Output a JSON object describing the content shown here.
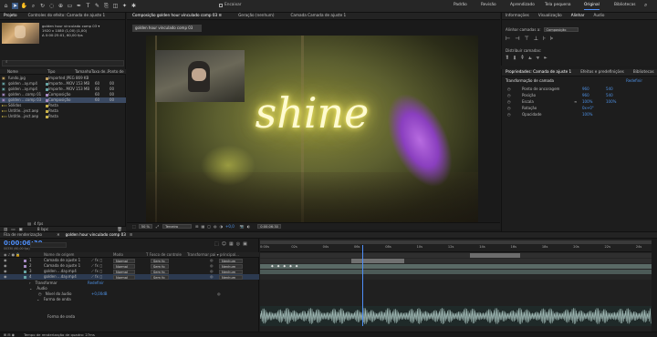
{
  "toolbar": {
    "tools": [
      "home-icon",
      "selection-tool-icon",
      "hand-tool-icon",
      "zoom-tool-icon",
      "rotate-tool-icon",
      "orbit-camera-icon",
      "pan-behind-icon",
      "rectangle-tool-icon",
      "pen-tool-icon",
      "type-tool-icon",
      "brush-tool-icon",
      "clone-stamp-icon",
      "eraser-tool-icon",
      "roto-brush-icon",
      "puppet-pin-icon"
    ],
    "snap_label": "Encaixar",
    "workspaces": [
      "Padrão",
      "Revisão",
      "Aprendizado",
      "Tela pequena",
      "Original",
      "Bibliotecas"
    ],
    "active_workspace": "Original"
  },
  "project": {
    "tab": "Projeto",
    "controls_tab": "Controles do efeito: Camada de ajuste 1",
    "preview_name": "golden hour vinculado comp 03 ▾",
    "preview_info1": "1920 x 1080 (1,00) (1,00)",
    "preview_info2": "Δ 0:00:25:01, 60,00 fps",
    "search_placeholder": "⌕",
    "columns": [
      "Nome",
      "Tipo",
      "Tamanho",
      "Taxa de...",
      "Ponto de"
    ],
    "items": [
      {
        "name": "fundo.jpg",
        "type": "Imported JPEG",
        "size": "869 KB",
        "rate": "",
        "point": "",
        "color": "#c0a060"
      },
      {
        "name": "golden ..ay.mp4",
        "type": "Importe...MOV",
        "size": "153 MB",
        "rate": "60",
        "point": "00",
        "color": "#66a3a3"
      },
      {
        "name": "golden ..ay.mp4",
        "type": "Importe...MOV",
        "size": "153 MB",
        "rate": "60",
        "point": "00",
        "color": "#66a3a3"
      },
      {
        "name": "golden ...comp 01",
        "type": "Composição",
        "size": "",
        "rate": "60",
        "point": "00",
        "color": "#a58ac2"
      },
      {
        "name": "golden ...comp 03",
        "type": "Composição",
        "size": "",
        "rate": "60",
        "point": "00",
        "color": "#a58ac2"
      },
      {
        "name": "Sólidos",
        "type": "Pasta",
        "size": "",
        "rate": "",
        "point": "",
        "color": "#c9b24a"
      },
      {
        "name": "Untitle...ject.aep",
        "type": "Pasta",
        "size": "",
        "rate": "",
        "point": "",
        "color": "#c9b24a"
      },
      {
        "name": "Untitle...ject.aep",
        "type": "Pasta",
        "size": "",
        "rate": "",
        "point": "",
        "color": "#c9b24a"
      }
    ],
    "bpc": "8 bpc"
  },
  "viewer": {
    "tabs": [
      "Composição golden hour vinculado comp 03 ≡",
      "Geração (nenhum)",
      "Camada Camada de ajuste 1"
    ],
    "comp_tag": "golden hour vinculado comp 03",
    "overlay_text": "shine",
    "zoom": "50 %",
    "quality": "Terceiro",
    "time": "0:00:06:30",
    "plus": "+0,0"
  },
  "info_panel": {
    "tabs": [
      "Informações",
      "Visualização",
      "Alinhar",
      "Áudio"
    ],
    "align_label": "Alinhar camadas a:",
    "align_target": "Composição",
    "distribute_label": "Distribuir camadas:"
  },
  "properties": {
    "tabs": [
      "Propriedades: Camada de ajuste 1",
      "Efeitos e predefinições",
      "Bibliotecas"
    ],
    "section": "Transformação de camada",
    "reset": "Redefinir",
    "rows": [
      {
        "label": "Ponto de ancoragem",
        "v1": "960",
        "v2": "540"
      },
      {
        "label": "Posição",
        "v1": "960",
        "v2": "540"
      },
      {
        "label": "Escala",
        "v1": "100%",
        "v2": "100%"
      },
      {
        "label": "Rotação",
        "v1": "0x+0°",
        "v2": ""
      },
      {
        "label": "Opacidade",
        "v1": "100%",
        "v2": ""
      }
    ]
  },
  "render_queue": {
    "tab": "Fila de renderização",
    "fps": "4 fps"
  },
  "timeline": {
    "tab": "golden hour vinculado comp 03",
    "current_time": "0:00:06:30",
    "frame_sub": "00330 (60,00 fps)",
    "columns": [
      "Nome de origem",
      "Modo",
      "T Fosco de controle",
      "Transformar pai ▾ principal..."
    ],
    "layers": [
      {
        "num": "1",
        "name": "Camada de ajuste 1",
        "mode": "Normal",
        "matte": "Sem fo",
        "parent": "Nenhum",
        "color": "#a58ac2"
      },
      {
        "num": "2",
        "name": "Camada de ajuste 1",
        "mode": "Normal",
        "matte": "Sem fo",
        "parent": "Nenhum",
        "color": "#a58ac2"
      },
      {
        "num": "3",
        "name": "golden ...day.mp4",
        "mode": "Normal",
        "matte": "Sem fo",
        "parent": "Nenhum",
        "color": "#66a3a3"
      },
      {
        "num": "4",
        "name": "golden ...day.mp4",
        "mode": "Normal",
        "matte": "Sem fo",
        "parent": "Nenhum",
        "color": "#66a3a3"
      }
    ],
    "transform_label": "Transformar",
    "transform_reset": "Redefinir",
    "audio_label": "Áudio",
    "audio_level_label": "Nível do áudio",
    "audio_level_value": "+0,00dB",
    "waveform_label": "Forma de onda",
    "waveform_label2": "Forma de onda",
    "ruler": [
      "0:00s",
      "02s",
      "04s",
      "06s",
      "08s",
      "10s",
      "12s",
      "14s",
      "16s",
      "18s",
      "20s",
      "22s",
      "24s"
    ],
    "playhead_seconds": 6.5,
    "duration_seconds": 25,
    "render_time": "Tempo de renderização de quadro: 27ms"
  },
  "colors": {
    "accent": "#4e8ef7",
    "highlight_blue": "#3b5a86",
    "glow": "#fff7a6"
  }
}
